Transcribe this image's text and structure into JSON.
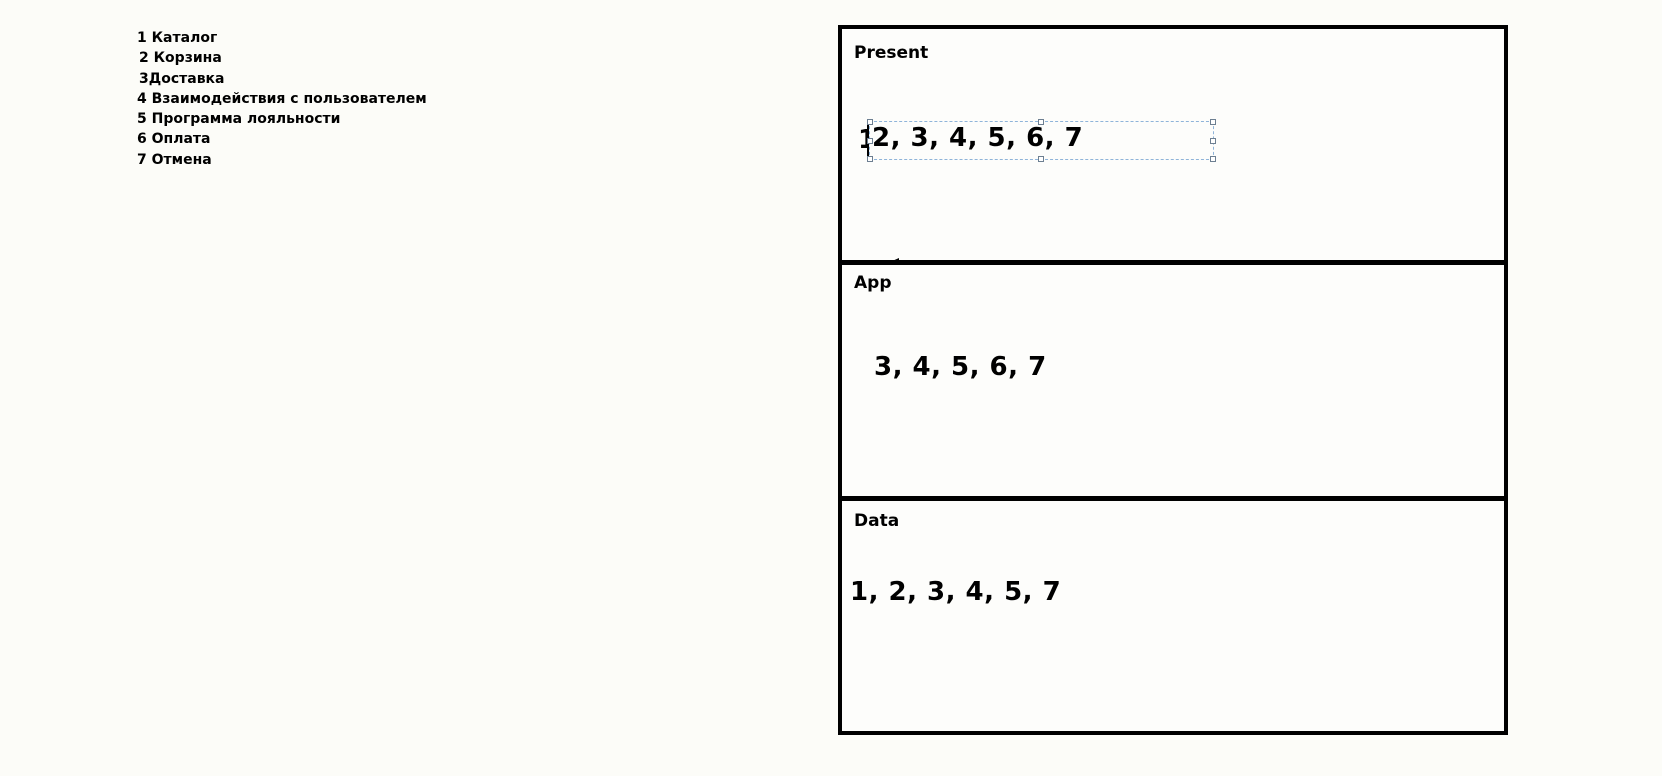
{
  "module_list": [
    "1 Каталог",
    "2 Корзина",
    "3Доставка",
    "4 Взаимодействия с пользователем",
    "5 Программа лояльности",
    "6 Оплата",
    "7 Отмена"
  ],
  "layers": {
    "present": {
      "title": "Present",
      "first_digit": "1",
      "value": "2, 3, 4, 5, 6, 7"
    },
    "app": {
      "title": "App",
      "value": "3, 4, 5, 6, 7"
    },
    "data": {
      "title": "Data",
      "value": "1, 2, 3, 4, 5, 7"
    }
  }
}
